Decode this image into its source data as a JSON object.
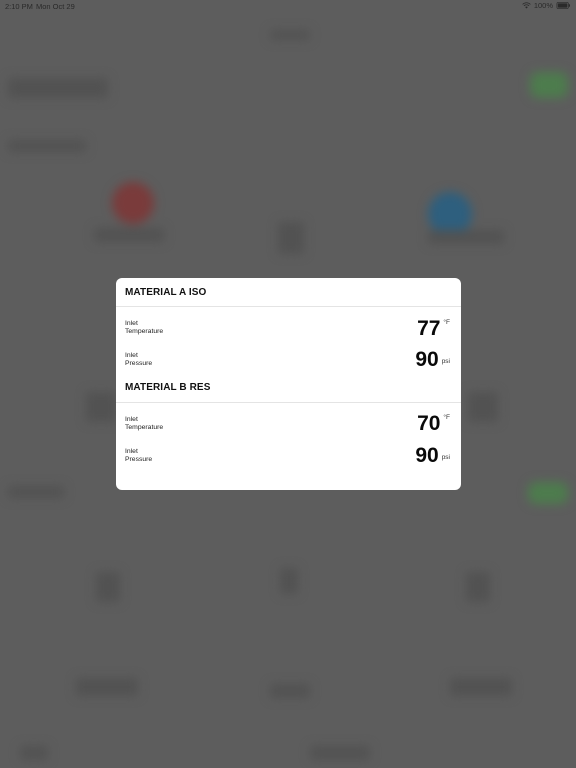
{
  "status_bar": {
    "time": "2:10 PM",
    "date": "Mon Oct 29",
    "battery": "100%",
    "wifi_icon": "wifi-icon",
    "battery_icon": "battery-icon"
  },
  "modal": {
    "sections": [
      {
        "title": "MATERIAL A ISO",
        "rows": [
          {
            "label_line1": "Inlet",
            "label_line2": "Temperature",
            "value": "77",
            "unit": "°F"
          },
          {
            "label_line1": "Inlet",
            "label_line2": "Pressure",
            "value": "90",
            "unit": "psi"
          }
        ]
      },
      {
        "title": "MATERIAL B RES",
        "rows": [
          {
            "label_line1": "Inlet",
            "label_line2": "Temperature",
            "value": "70",
            "unit": "°F"
          },
          {
            "label_line1": "Inlet",
            "label_line2": "Pressure",
            "value": "90",
            "unit": "psi"
          }
        ]
      }
    ]
  },
  "colors": {
    "overlay": "#5d5d5d",
    "modal_background": "#ffffff",
    "indicator_a": "#7a3b3b",
    "indicator_b": "#2e5f7e",
    "status_ok": "#4d7c4d"
  }
}
